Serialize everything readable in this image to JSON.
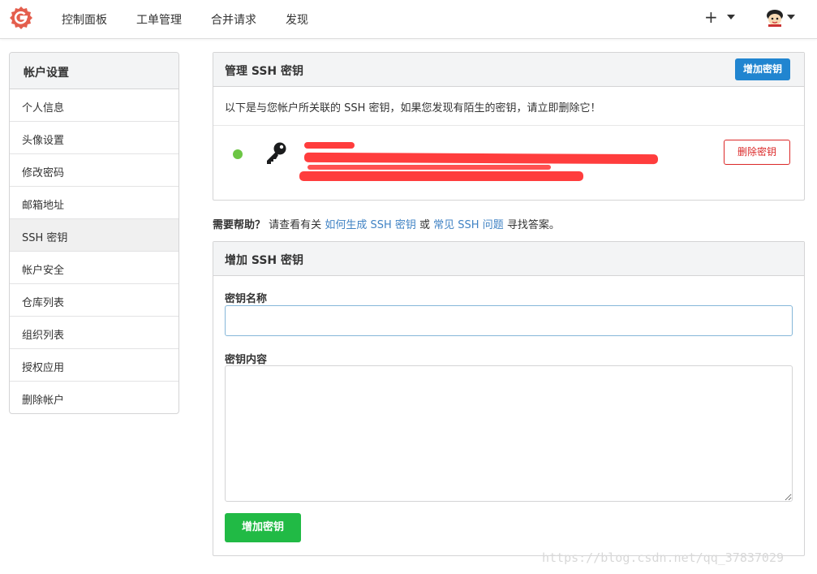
{
  "nav": {
    "items": [
      "控制面板",
      "工单管理",
      "合并请求",
      "发现"
    ],
    "plus_label": "+",
    "logo": "gitea-logo-icon",
    "avatar": "user-avatar-icon"
  },
  "sidebar": {
    "title": "帐户设置",
    "items": [
      {
        "label": "个人信息",
        "active": false
      },
      {
        "label": "头像设置",
        "active": false
      },
      {
        "label": "修改密码",
        "active": false
      },
      {
        "label": "邮箱地址",
        "active": false
      },
      {
        "label": "SSH 密钥",
        "active": true
      },
      {
        "label": "帐户安全",
        "active": false
      },
      {
        "label": "仓库列表",
        "active": false
      },
      {
        "label": "组织列表",
        "active": false
      },
      {
        "label": "授权应用",
        "active": false
      },
      {
        "label": "删除帐户",
        "active": false
      }
    ]
  },
  "manage": {
    "title": "管理 SSH 密钥",
    "add_button": "增加密钥",
    "notice": "以下是与您帐户所关联的 SSH 密钥，如果您发现有陌生的密钥，请立即删除它！",
    "key_entry": {
      "status_color": "#6cc644",
      "icon": "key-icon",
      "delete_button": "删除密钥"
    }
  },
  "help": {
    "prefix": "需要帮助？",
    "text1": "请查看有关",
    "link1": "如何生成 SSH 密钥",
    "text2": "或",
    "link2": "常见 SSH 问题",
    "text3": "寻找答案。"
  },
  "add_form": {
    "title": "增加 SSH 密钥",
    "name_label": "密钥名称",
    "name_value": "",
    "content_label": "密钥内容",
    "content_value": "",
    "submit_button": "增加密钥"
  },
  "watermark": "https://blog.csdn.net/qq_37837029",
  "colors": {
    "primary": "#2185d0",
    "success": "#21ba45",
    "danger": "#db2828",
    "link": "#4183c4",
    "redaction": "#ff3333"
  }
}
